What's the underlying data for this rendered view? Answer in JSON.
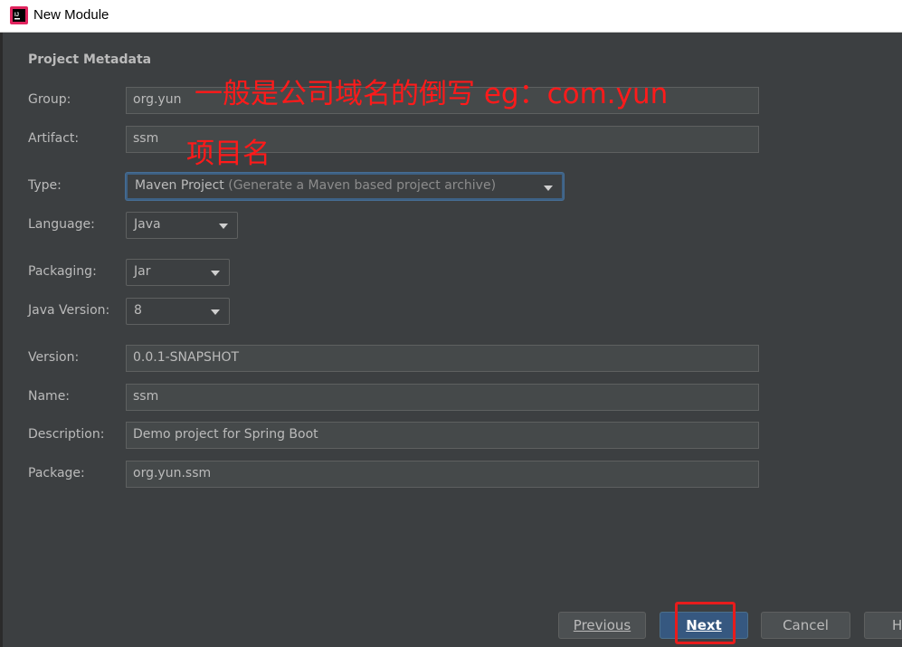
{
  "window": {
    "title": "New Module"
  },
  "section": {
    "title": "Project Metadata"
  },
  "form": {
    "group": {
      "label": "Group:",
      "value": "org.yun"
    },
    "artifact": {
      "label": "Artifact:",
      "value": "ssm"
    },
    "type": {
      "label": "Type:",
      "value": "Maven Project",
      "hint": "(Generate a Maven based project archive)"
    },
    "language": {
      "label": "Language:",
      "value": "Java"
    },
    "packaging": {
      "label": "Packaging:",
      "value": "Jar"
    },
    "java_version": {
      "label": "Java Version:",
      "value": "8"
    },
    "version": {
      "label": "Version:",
      "value": "0.0.1-SNAPSHOT"
    },
    "name": {
      "label": "Name:",
      "value": "ssm"
    },
    "description": {
      "label": "Description:",
      "value": "Demo project for Spring Boot"
    },
    "package": {
      "label": "Package:",
      "value": "org.yun.ssm"
    }
  },
  "annotations": {
    "group_note": "一般是公司域名的倒写 eg：com.yun",
    "artifact_note": "项目名"
  },
  "buttons": {
    "previous": "Previous",
    "next": "Next",
    "cancel": "Cancel",
    "help": "H"
  },
  "colors": {
    "annotation": "#ff1a1a",
    "highlight_box": "#e81c1c",
    "background": "#3c3f41"
  }
}
